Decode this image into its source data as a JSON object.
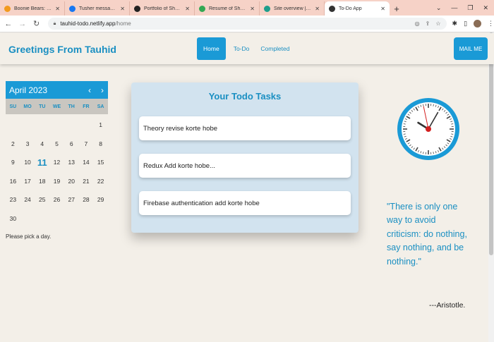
{
  "browser": {
    "tabs": [
      {
        "title": "Boonie Bears: Back to",
        "favicon_color": "#f29a1f"
      },
      {
        "title": "Tusher messaged US-",
        "favicon_color": "#1877f2"
      },
      {
        "title": "Portfolio of Shahid",
        "favicon_color": "#222222"
      },
      {
        "title": "Resume of Shahidul Is",
        "favicon_color": "#34a853"
      },
      {
        "title": "Site overview | tauhid",
        "favicon_color": "#1f9e8c"
      },
      {
        "title": "To-Do App",
        "favicon_color": "#333333"
      }
    ],
    "url_host": "tauhid-todo.netlify.app",
    "url_path": "/home"
  },
  "header": {
    "brand": "Greetings From Tauhid",
    "nav": [
      "Home",
      "To-Do",
      "Completed"
    ],
    "active_nav": "Home",
    "mail_button": "MAIL ME"
  },
  "calendar": {
    "month_label": "April 2023",
    "weekdays": [
      "SU",
      "MO",
      "TU",
      "WE",
      "TH",
      "FR",
      "SA"
    ],
    "days": [
      "",
      "",
      "",
      "",
      "",
      "",
      "1",
      "2",
      "3",
      "4",
      "5",
      "6",
      "7",
      "8",
      "9",
      "10",
      "11",
      "12",
      "13",
      "14",
      "15",
      "16",
      "17",
      "18",
      "19",
      "20",
      "21",
      "22",
      "23",
      "24",
      "25",
      "26",
      "27",
      "28",
      "29",
      "30"
    ],
    "today": "11",
    "message": "Please pick a day."
  },
  "todo": {
    "title": "Your Todo Tasks",
    "items": [
      "Theory revise korte hobe",
      "Redux Add korte hobe...",
      "Firebase authentication add korte hobe"
    ]
  },
  "clock": {
    "hours": 10,
    "minutes": 4,
    "seconds": 58
  },
  "quote": {
    "text": "\"There is only one way to avoid criticism: do nothing, say nothing, and be nothing.\"",
    "author": "---Aristotle."
  },
  "colors": {
    "accent": "#1a9ad6",
    "background": "#f3efe8",
    "card": "#d2e3ef"
  }
}
